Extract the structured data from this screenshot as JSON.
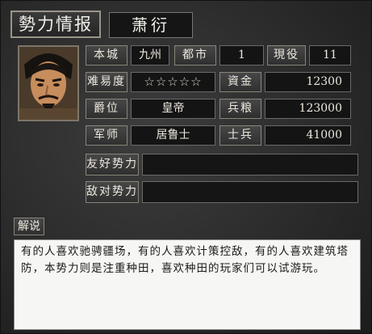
{
  "window": {
    "title": "勢力情报",
    "faction_name": "萧衍"
  },
  "portrait": {
    "icon": "ruler-portrait"
  },
  "stats": {
    "home_city_label": "本城",
    "home_city_value": "九州",
    "cities_label": "都市",
    "cities_value": "1",
    "units_label": "現役",
    "units_value": "11",
    "difficulty_label": "难易度",
    "difficulty_stars": "☆☆☆☆☆",
    "difficulty_level": 0,
    "gold_label": "資金",
    "gold_value": "12300",
    "rank_label": "爵位",
    "rank_value": "皇帝",
    "food_label": "兵粮",
    "food_value": "123000",
    "advisor_label": "军师",
    "advisor_value": "居鲁士",
    "soldiers_label": "士兵",
    "soldiers_value": "41000"
  },
  "relations": {
    "friendly_label": "友好势力",
    "friendly_value": "",
    "hostile_label": "敌对势力",
    "hostile_value": ""
  },
  "description": {
    "tab_label": "解说",
    "text": "有的人喜欢驰骋疆场，有的人喜欢计策控敌，有的人喜欢建筑塔防，本势力则是注重种田，喜欢种田的玩家们可以试游玩。"
  }
}
